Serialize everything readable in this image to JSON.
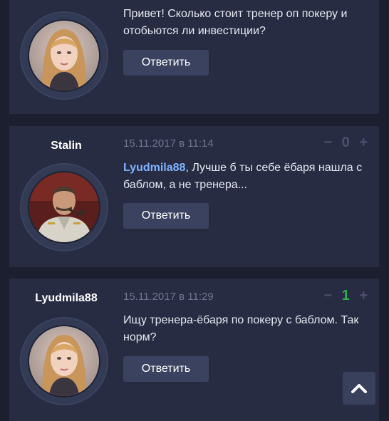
{
  "posts": [
    {
      "author": "",
      "date": "",
      "rating": null,
      "text": "Привет! Сколько стоит тренер оп покеру и отобьются ли инвестиции?",
      "reply_label": "Ответить",
      "avatar": "woman-blonde-avatar"
    },
    {
      "author": "Stalin",
      "date": "15.11.2017 в 11:14",
      "rating": {
        "minus": "−",
        "score": "0",
        "plus": "+"
      },
      "mention": "Lyudmila88",
      "text": ", Лучше б ты себе ёбаря нашла с баблом, а не тренера...",
      "reply_label": "Ответить",
      "avatar": "man-uniform-pipe-avatar"
    },
    {
      "author": "Lyudmila88",
      "date": "15.11.2017 в 11:29",
      "rating": {
        "minus": "−",
        "score": "1",
        "plus": "+"
      },
      "text": "Ищу тренера-ёбаря по покеру с баблом. Так норм?",
      "reply_label": "Ответить",
      "avatar": "woman-blonde-avatar"
    }
  ],
  "scroll_top": {
    "icon": "chevron-up-icon"
  },
  "colors": {
    "background": "#1b1f2f",
    "card": "#272c42",
    "button": "#3a4260",
    "mention": "#7fb3ff",
    "positive": "#2fae4c",
    "muted": "#6e7693"
  }
}
